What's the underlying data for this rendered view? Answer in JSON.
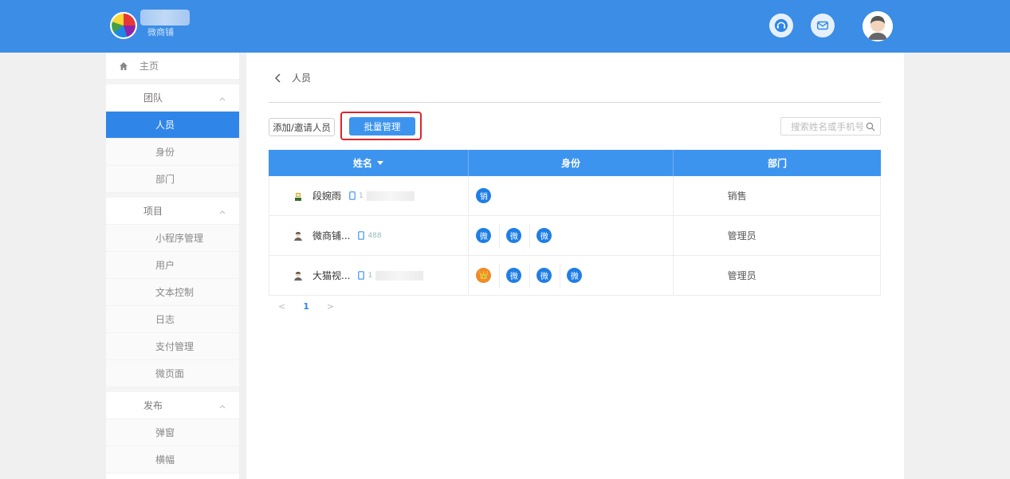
{
  "header": {
    "brand_text": "微商铺",
    "accent": "#3b8de6"
  },
  "icons": {
    "support": "headset-icon",
    "mail": "mail-icon",
    "user": "avatar-icon"
  },
  "sidebar": {
    "home": "主页",
    "groups": [
      {
        "label": "团队",
        "items": [
          "人员",
          "身份",
          "部门"
        ]
      },
      {
        "label": "项目",
        "items": [
          "小程序管理",
          "用户",
          "文本控制",
          "日志",
          "支付管理",
          "微页面"
        ]
      },
      {
        "label": "发布",
        "items": [
          "弹窗",
          "横幅"
        ]
      }
    ],
    "active_item": "人员"
  },
  "breadcrumb": {
    "current": "人员"
  },
  "toolbar": {
    "invite_label": "添加/邀请人员",
    "batch_label": "批量管理",
    "search_placeholder": "搜索姓名或手机号"
  },
  "table": {
    "headers": [
      "姓名",
      "身份",
      "部门"
    ],
    "rows": [
      {
        "name": "段婉雨",
        "phone": "1",
        "badges": [
          "销"
        ],
        "dept": "销售"
      },
      {
        "name": "微商铺...",
        "phone": "488",
        "badges": [
          "微",
          "微",
          "微"
        ],
        "dept": "管理员"
      },
      {
        "name": "大猫视...",
        "phone": "1",
        "badges": [
          "👑",
          "微",
          "微",
          "微"
        ],
        "dept": "管理员"
      }
    ]
  },
  "pagination": {
    "prev": "<",
    "current": "1",
    "next": ">"
  }
}
